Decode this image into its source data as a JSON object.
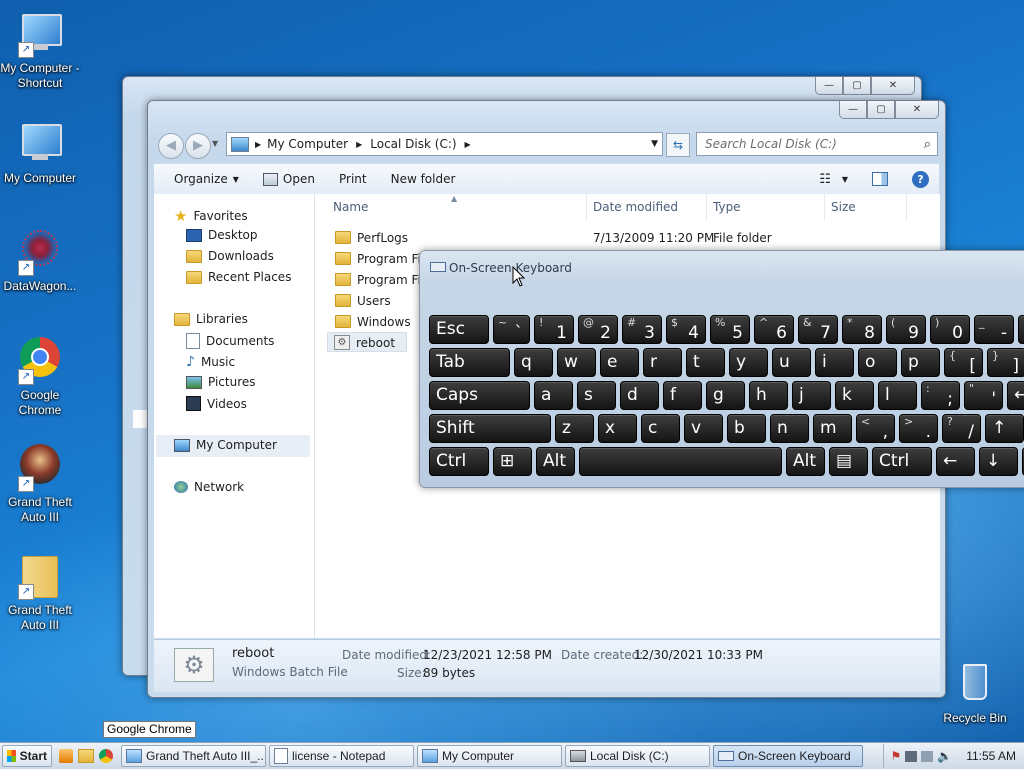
{
  "desktop": {
    "icons": [
      {
        "label": "My Computer - Shortcut"
      },
      {
        "label": "My Computer"
      },
      {
        "label": "DataWagon..."
      },
      {
        "label": "Google Chrome"
      },
      {
        "label": "Grand Theft Auto III"
      },
      {
        "label": "Grand Theft Auto III"
      },
      {
        "label": "Recycle Bin"
      }
    ],
    "tooltip": "Google Chrome"
  },
  "explorer": {
    "breadcrumb": [
      "My Computer",
      "Local Disk (C:)"
    ],
    "search_placeholder": "Search Local Disk (C:)",
    "toolbar": {
      "organize": "Organize",
      "open": "Open",
      "print": "Print",
      "new_folder": "New folder"
    },
    "nav": {
      "favorites": "Favorites",
      "favorites_items": [
        "Desktop",
        "Downloads",
        "Recent Places"
      ],
      "libraries": "Libraries",
      "libraries_items": [
        "Documents",
        "Music",
        "Pictures",
        "Videos"
      ],
      "computer": "My Computer",
      "network": "Network"
    },
    "columns": {
      "name": "Name",
      "date": "Date modified",
      "type": "Type",
      "size": "Size"
    },
    "files": [
      {
        "name": "PerfLogs",
        "date": "7/13/2009 11:20 PM",
        "type": "File folder"
      },
      {
        "name": "Program Files",
        "date": "",
        "type": ""
      },
      {
        "name": "Program Files (x86)",
        "date": "",
        "type": ""
      },
      {
        "name": "Users",
        "date": "",
        "type": ""
      },
      {
        "name": "Windows",
        "date": "",
        "type": ""
      },
      {
        "name": "reboot",
        "date": "",
        "type": ""
      }
    ],
    "details": {
      "name": "reboot",
      "filetype": "Windows Batch File",
      "modified_label": "Date modified:",
      "modified": "12/23/2021 12:58 PM",
      "created_label": "Date created:",
      "created": "12/30/2021 10:33 PM",
      "size_label": "Size:",
      "size": "89 bytes"
    }
  },
  "osk": {
    "title": "On-Screen Keyboard",
    "rows": [
      [
        {
          "main": "Esc"
        },
        {
          "main": "` ",
          "shift": "~"
        },
        {
          "main": "1",
          "shift": "!"
        },
        {
          "main": "2",
          "shift": "@"
        },
        {
          "main": "3",
          "shift": "#"
        },
        {
          "main": "4",
          "shift": "$"
        },
        {
          "main": "5",
          "shift": "%"
        },
        {
          "main": "6",
          "shift": "^"
        },
        {
          "main": "7",
          "shift": "&"
        },
        {
          "main": "8",
          "shift": "*"
        },
        {
          "main": "9",
          "shift": "("
        },
        {
          "main": "0",
          "shift": ")"
        },
        {
          "main": "-",
          "shift": "_"
        },
        {
          "main": "=",
          "shift": "+"
        }
      ],
      [
        {
          "main": "Tab"
        },
        {
          "main": "q"
        },
        {
          "main": "w"
        },
        {
          "main": "e"
        },
        {
          "main": "r"
        },
        {
          "main": "t"
        },
        {
          "main": "y"
        },
        {
          "main": "u"
        },
        {
          "main": "i"
        },
        {
          "main": "o"
        },
        {
          "main": "p"
        },
        {
          "main": "[",
          "shift": "{"
        },
        {
          "main": "]",
          "shift": "}"
        },
        {
          "main": "\\",
          "shift": "|"
        }
      ],
      [
        {
          "main": "Caps"
        },
        {
          "main": "a"
        },
        {
          "main": "s"
        },
        {
          "main": "d"
        },
        {
          "main": "f"
        },
        {
          "main": "g"
        },
        {
          "main": "h"
        },
        {
          "main": "j"
        },
        {
          "main": "k"
        },
        {
          "main": "l"
        },
        {
          "main": ";",
          "shift": ":"
        },
        {
          "main": "'",
          "shift": "\""
        },
        {
          "main": "←"
        }
      ],
      [
        {
          "main": "Shift"
        },
        {
          "main": "z"
        },
        {
          "main": "x"
        },
        {
          "main": "c"
        },
        {
          "main": "v"
        },
        {
          "main": "b"
        },
        {
          "main": "n"
        },
        {
          "main": "m"
        },
        {
          "main": ",",
          "shift": "<"
        },
        {
          "main": ".",
          "shift": ">"
        },
        {
          "main": "/",
          "shift": "?"
        },
        {
          "main": "↑"
        },
        {
          "main": ""
        }
      ],
      [
        {
          "main": "Ctrl"
        },
        {
          "main": "⊞"
        },
        {
          "main": "Alt"
        },
        {
          "main": ""
        },
        {
          "main": "Alt"
        },
        {
          "main": "▤"
        },
        {
          "main": "Ctrl"
        },
        {
          "main": "←"
        },
        {
          "main": "↓"
        },
        {
          "main": ""
        }
      ]
    ]
  },
  "taskbar": {
    "start": "Start",
    "buttons": [
      {
        "label": "Grand Theft Auto III_..."
      },
      {
        "label": "license - Notepad"
      },
      {
        "label": "My Computer"
      },
      {
        "label": "Local Disk (C:)"
      },
      {
        "label": "On-Screen Keyboard"
      }
    ],
    "clock": "11:55 AM"
  }
}
